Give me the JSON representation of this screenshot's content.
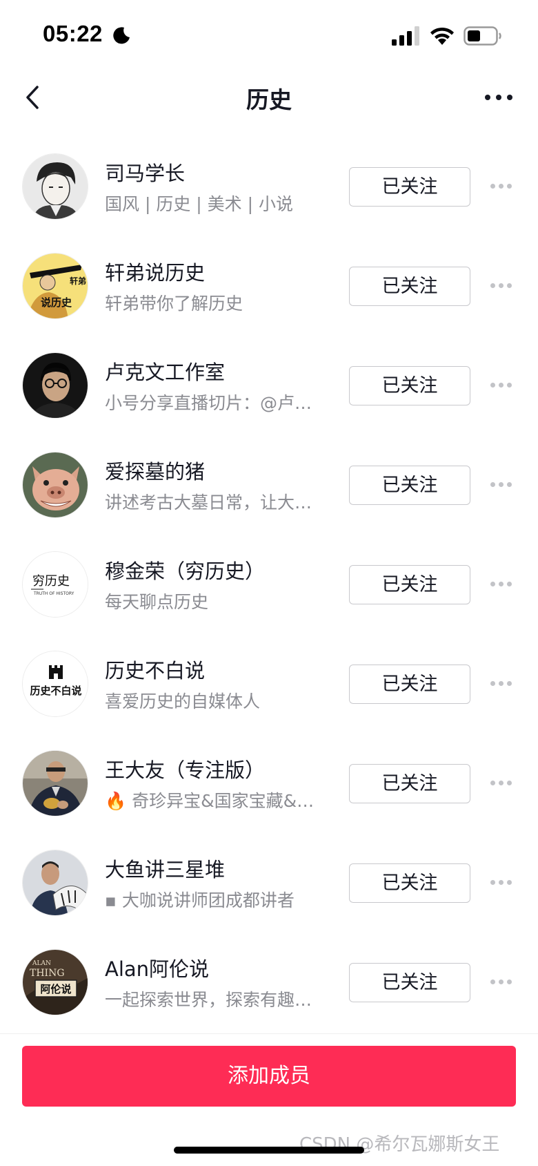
{
  "status_bar": {
    "time": "05:22",
    "icons": [
      "moon-icon",
      "signal-icon",
      "wifi-icon",
      "battery-icon"
    ]
  },
  "header": {
    "title": "历史",
    "back_icon": "chevron-left-icon",
    "more_icon": "more-horizontal-icon"
  },
  "members": [
    {
      "name": "司马学长",
      "desc": "国风 | 历史 | 美术 | 小说",
      "button": "已关注"
    },
    {
      "name": "轩弟说历史",
      "desc": "轩弟带你了解历史",
      "button": "已关注"
    },
    {
      "name": "卢克文工作室",
      "desc": "小号分享直播切片：@卢…",
      "button": "已关注"
    },
    {
      "name": "爱探墓的猪",
      "desc": "讲述考古大墓日常，让大…",
      "button": "已关注"
    },
    {
      "name": "穆金荣（穷历史）",
      "desc": "每天聊点历史",
      "button": "已关注"
    },
    {
      "name": "历史不白说",
      "desc": "喜爱历史的自媒体人",
      "button": "已关注"
    },
    {
      "name": "王大友（专注版）",
      "desc": "🔥 奇珍异宝&国家宝藏&…",
      "button": "已关注"
    },
    {
      "name": "大鱼讲三星堆",
      "desc": "▪ 大咖说讲师团成都讲者",
      "button": "已关注"
    },
    {
      "name": "Alan阿伦说",
      "desc": "一起探索世界，探索有趣…",
      "button": "已关注"
    }
  ],
  "avatar_text": {
    "xuandi_top": "轩弟",
    "xuandi_bottom": "说历史",
    "qiong": "穷历史",
    "qiong_sub": "TRUTH OF HISTORY",
    "bubaishuo": "历史不白说",
    "alan_top": "ALAN",
    "alan_mid": "THING",
    "alan_seal": "阿伦说"
  },
  "footer": {
    "add_button": "添加成员",
    "watermark": "CSDN @希尔瓦娜斯女王"
  },
  "colors": {
    "accent": "#fe2c55",
    "text": "#161823",
    "secondary_text": "#8a8b91",
    "button_border": "#c8c8cc"
  }
}
